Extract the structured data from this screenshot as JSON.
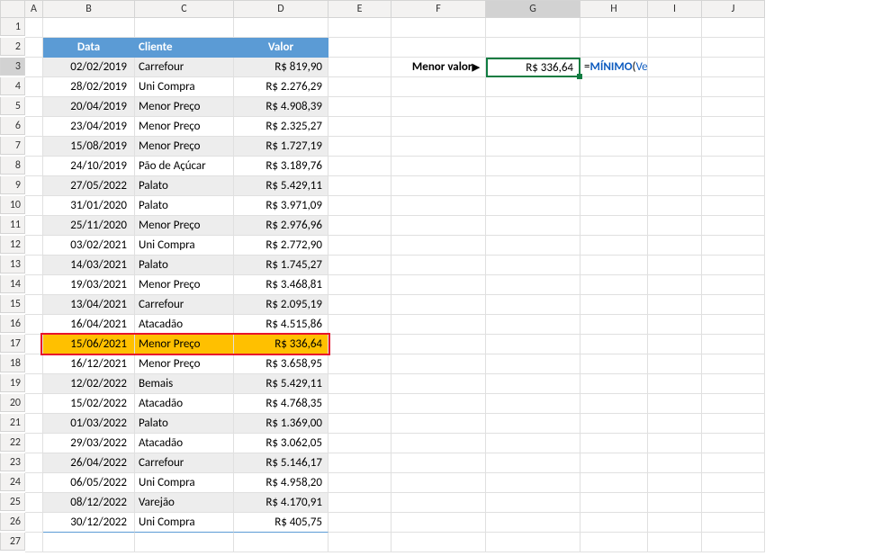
{
  "columns": [
    "A",
    "B",
    "C",
    "D",
    "E",
    "F",
    "G",
    "H",
    "I",
    "J"
  ],
  "row_count": 27,
  "selected_cell": "G3",
  "table": {
    "headers": {
      "data": "Data",
      "cliente": "Cliente",
      "valor": "Valor"
    },
    "rows": [
      {
        "data": "02/02/2019",
        "cliente": "Carrefour",
        "valor": "R$ 819,90"
      },
      {
        "data": "28/02/2019",
        "cliente": "Uni Compra",
        "valor": "R$ 2.276,29"
      },
      {
        "data": "20/04/2019",
        "cliente": "Menor Preço",
        "valor": "R$ 4.908,39"
      },
      {
        "data": "23/04/2019",
        "cliente": "Menor Preço",
        "valor": "R$ 2.325,27"
      },
      {
        "data": "15/08/2019",
        "cliente": "Menor Preço",
        "valor": "R$ 1.727,19"
      },
      {
        "data": "24/10/2019",
        "cliente": "Pão de Açúcar",
        "valor": "R$ 3.189,76"
      },
      {
        "data": "27/05/2022",
        "cliente": "Palato",
        "valor": "R$ 5.429,11"
      },
      {
        "data": "31/01/2020",
        "cliente": "Palato",
        "valor": "R$ 3.971,09"
      },
      {
        "data": "25/11/2020",
        "cliente": "Menor Preço",
        "valor": "R$ 2.976,96"
      },
      {
        "data": "03/02/2021",
        "cliente": "Uni Compra",
        "valor": "R$ 2.772,90"
      },
      {
        "data": "14/03/2021",
        "cliente": "Palato",
        "valor": "R$ 1.745,27"
      },
      {
        "data": "19/03/2021",
        "cliente": "Menor Preço",
        "valor": "R$ 3.468,81"
      },
      {
        "data": "13/04/2021",
        "cliente": "Carrefour",
        "valor": "R$ 2.095,19"
      },
      {
        "data": "16/04/2021",
        "cliente": "Atacadão",
        "valor": "R$ 4.515,86"
      },
      {
        "data": "15/06/2021",
        "cliente": "Menor Preço",
        "valor": "R$ 336,64"
      },
      {
        "data": "16/12/2021",
        "cliente": "Menor Preço",
        "valor": "R$ 3.658,95"
      },
      {
        "data": "12/02/2022",
        "cliente": "Bemais",
        "valor": "R$ 5.429,11"
      },
      {
        "data": "15/02/2022",
        "cliente": "Atacadão",
        "valor": "R$ 4.768,35"
      },
      {
        "data": "01/03/2022",
        "cliente": "Palato",
        "valor": "R$ 1.369,00"
      },
      {
        "data": "29/03/2022",
        "cliente": "Atacadão",
        "valor": "R$ 3.062,05"
      },
      {
        "data": "26/04/2022",
        "cliente": "Carrefour",
        "valor": "R$ 5.146,17"
      },
      {
        "data": "06/05/2022",
        "cliente": "Uni Compra",
        "valor": "R$ 4.958,20"
      },
      {
        "data": "08/12/2022",
        "cliente": "Varejão",
        "valor": "R$ 4.170,91"
      },
      {
        "data": "30/12/2022",
        "cliente": "Uni Compra",
        "valor": "R$ 405,75"
      }
    ],
    "highlight_row_index": 14
  },
  "menor": {
    "label": "Menor valor",
    "arrow": "▶",
    "value": "R$ 336,64"
  },
  "formula": {
    "eq": "=",
    "fn": "MÍNIMO",
    "open": "(",
    "arg": "Vendas[Valor]",
    "close": ")"
  }
}
